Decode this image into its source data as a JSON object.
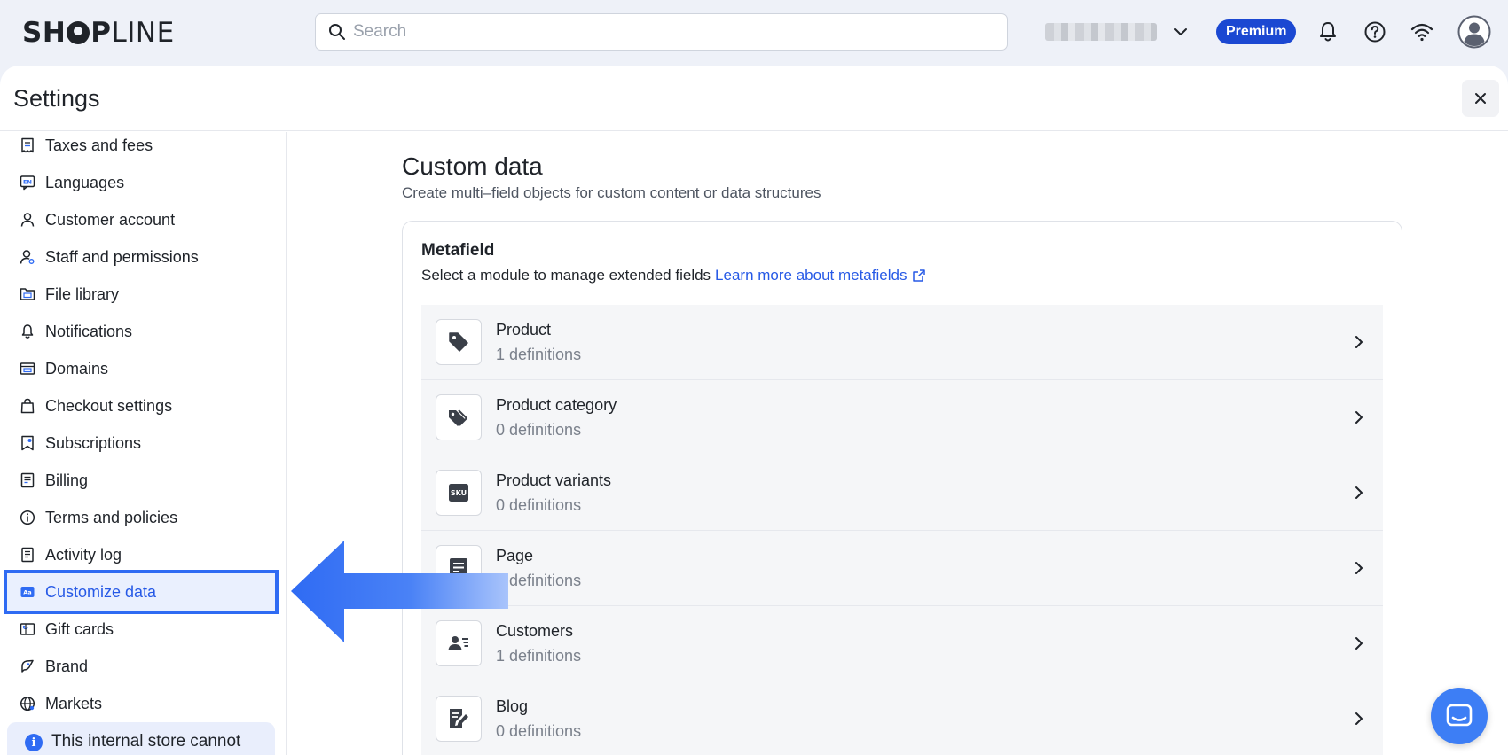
{
  "topbar": {
    "logo_bold": "SH",
    "logo_rest_bold": "P",
    "logo_light": "LINE",
    "search_placeholder": "Search",
    "plan_badge": "Premium"
  },
  "panel": {
    "title": "Settings"
  },
  "sidebar": {
    "items": [
      {
        "label": "Taxes and fees",
        "icon": "tax-icon"
      },
      {
        "label": "Languages",
        "icon": "language-icon"
      },
      {
        "label": "Customer account",
        "icon": "person-icon"
      },
      {
        "label": "Staff and permissions",
        "icon": "staff-icon"
      },
      {
        "label": "File library",
        "icon": "folder-icon"
      },
      {
        "label": "Notifications",
        "icon": "bell-icon"
      },
      {
        "label": "Domains",
        "icon": "domain-icon"
      },
      {
        "label": "Checkout settings",
        "icon": "bag-icon"
      },
      {
        "label": "Subscriptions",
        "icon": "subscription-icon"
      },
      {
        "label": "Billing",
        "icon": "billing-icon"
      },
      {
        "label": "Terms and policies",
        "icon": "info-icon"
      },
      {
        "label": "Activity log",
        "icon": "log-icon"
      },
      {
        "label": "Customize data",
        "icon": "custom-data-icon",
        "active": true
      },
      {
        "label": "Gift cards",
        "icon": "gift-card-icon"
      },
      {
        "label": "Brand",
        "icon": "brand-icon"
      },
      {
        "label": "Markets",
        "icon": "globe-icon"
      }
    ],
    "notice": "This internal store cannot"
  },
  "main": {
    "title": "Custom data",
    "subtitle": "Create multi–field objects for custom content or data structures",
    "card": {
      "title": "Metafield",
      "description": "Select a module to manage extended fields",
      "link": "Learn more about metafields",
      "modules": [
        {
          "name": "Product",
          "count": "1 definitions",
          "icon": "tag-icon"
        },
        {
          "name": "Product category",
          "count": "0 definitions",
          "icon": "tags-icon"
        },
        {
          "name": "Product variants",
          "count": "0 definitions",
          "icon": "sku-icon"
        },
        {
          "name": "Page",
          "count": "0 definitions",
          "icon": "page-icon"
        },
        {
          "name": "Customers",
          "count": "1 definitions",
          "icon": "customer-card-icon"
        },
        {
          "name": "Blog",
          "count": "0 definitions",
          "icon": "blog-edit-icon"
        }
      ]
    }
  },
  "colors": {
    "accent": "#2f6bf3",
    "premium": "#1b48d2",
    "link": "#2659e6"
  }
}
